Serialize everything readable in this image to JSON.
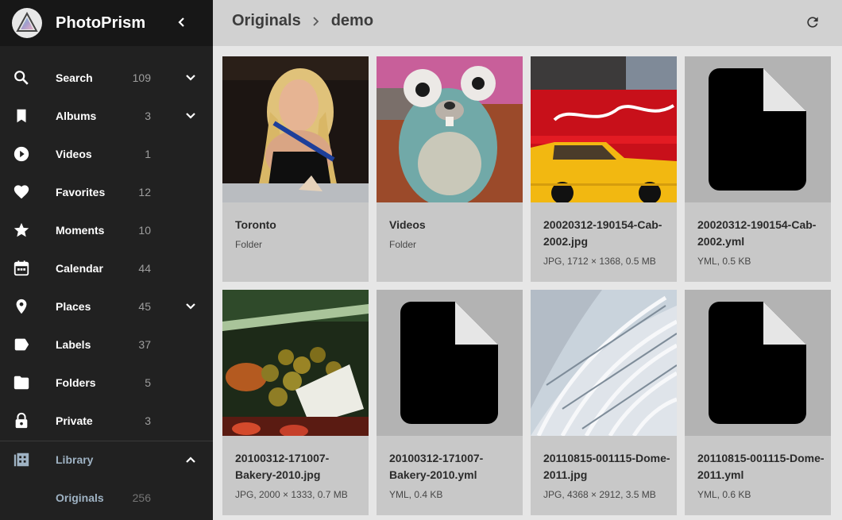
{
  "app": {
    "title": "PhotoPrism"
  },
  "sidebar": {
    "items": [
      {
        "label": "Search",
        "count": "109",
        "icon": "search-icon",
        "expandable": true
      },
      {
        "label": "Albums",
        "count": "3",
        "icon": "bookmark-icon",
        "expandable": true
      },
      {
        "label": "Videos",
        "count": "1",
        "icon": "play-circle-icon",
        "expandable": false
      },
      {
        "label": "Favorites",
        "count": "12",
        "icon": "heart-icon",
        "expandable": false
      },
      {
        "label": "Moments",
        "count": "10",
        "icon": "star-icon",
        "expandable": false
      },
      {
        "label": "Calendar",
        "count": "44",
        "icon": "calendar-icon",
        "expandable": false
      },
      {
        "label": "Places",
        "count": "45",
        "icon": "place-icon",
        "expandable": true
      },
      {
        "label": "Labels",
        "count": "37",
        "icon": "label-icon",
        "expandable": false
      },
      {
        "label": "Folders",
        "count": "5",
        "icon": "folder-icon",
        "expandable": false
      },
      {
        "label": "Private",
        "count": "3",
        "icon": "lock-icon",
        "expandable": false
      }
    ],
    "library": {
      "label": "Library",
      "icon": "library-icon"
    },
    "originals": {
      "label": "Originals",
      "count": "256"
    }
  },
  "toolbar": {
    "crumbs": [
      "Originals",
      "demo"
    ]
  },
  "cards": [
    {
      "title": "Toronto",
      "meta": "Folder",
      "thumb": "portrait"
    },
    {
      "title": "Videos",
      "meta": "Folder",
      "thumb": "gopher"
    },
    {
      "title": "20020312-190154-Cab-2002.jpg",
      "meta": "JPG, 1712 × 1368, 0.5 MB",
      "thumb": "cab"
    },
    {
      "title": "20020312-190154-Cab-2002.yml",
      "meta": "YML, 0.5 KB",
      "thumb": "file"
    },
    {
      "title": "20100312-171007-Bakery-2010.jpg",
      "meta": "JPG, 2000 × 1333, 0.7 MB",
      "thumb": "bakery"
    },
    {
      "title": "20100312-171007-Bakery-2010.yml",
      "meta": "YML, 0.4 KB",
      "thumb": "file"
    },
    {
      "title": "20110815-001115-Dome-2011.jpg",
      "meta": "JPG, 4368 × 2912, 3.5 MB",
      "thumb": "dome"
    },
    {
      "title": "20110815-001115-Dome-2011.yml",
      "meta": "YML, 0.6 KB",
      "thumb": "file"
    }
  ],
  "colors": {
    "sidebar_bg": "#212121",
    "brand_bg": "#171717",
    "toolbar_bg": "#d1d1d1",
    "card_bg": "#c8c8c8",
    "accent_text": "#9fb3c4"
  }
}
